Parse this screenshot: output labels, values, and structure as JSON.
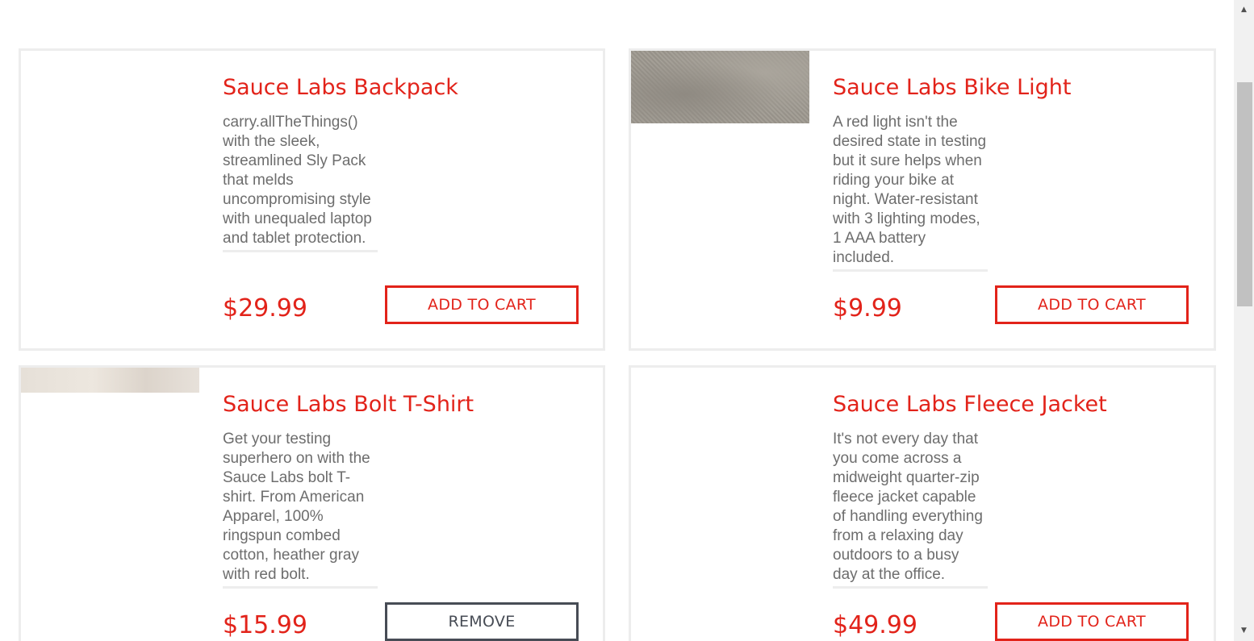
{
  "inventory": {
    "items": [
      {
        "name": "Sauce Labs Backpack",
        "description": "carry.allTheThings() with the sleek, streamlined Sly Pack that melds uncompromising style with unequaled laptop and tablet protection.",
        "price": "$29.99",
        "button_label": "ADD TO CART"
      },
      {
        "name": "Sauce Labs Bike Light",
        "description": "A red light isn't the desired state in testing but it sure helps when riding your bike at night. Water-resistant with 3 lighting modes, 1 AAA battery included.",
        "price": "$9.99",
        "button_label": "ADD TO CART"
      },
      {
        "name": "Sauce Labs Bolt T-Shirt",
        "description": "Get your testing superhero on with the Sauce Labs bolt T-shirt. From American Apparel, 100% ringspun combed cotton, heather gray with red bolt.",
        "price": "$15.99",
        "button_label": "REMOVE"
      },
      {
        "name": "Sauce Labs Fleece Jacket",
        "description": "It's not every day that you come across a midweight quarter-zip fleece jacket capable of handling everything from a relaxing day outdoors to a busy day at the office.",
        "price": "$49.99",
        "button_label": "ADD TO CART"
      }
    ]
  },
  "colors": {
    "accent": "#e2231a",
    "remove": "#474c55",
    "description_text": "#6d6d6d",
    "card_border": "#ededed"
  },
  "icons": {
    "scroll_up": "scroll-up-arrow-icon",
    "scroll_down": "scroll-down-arrow-icon"
  }
}
